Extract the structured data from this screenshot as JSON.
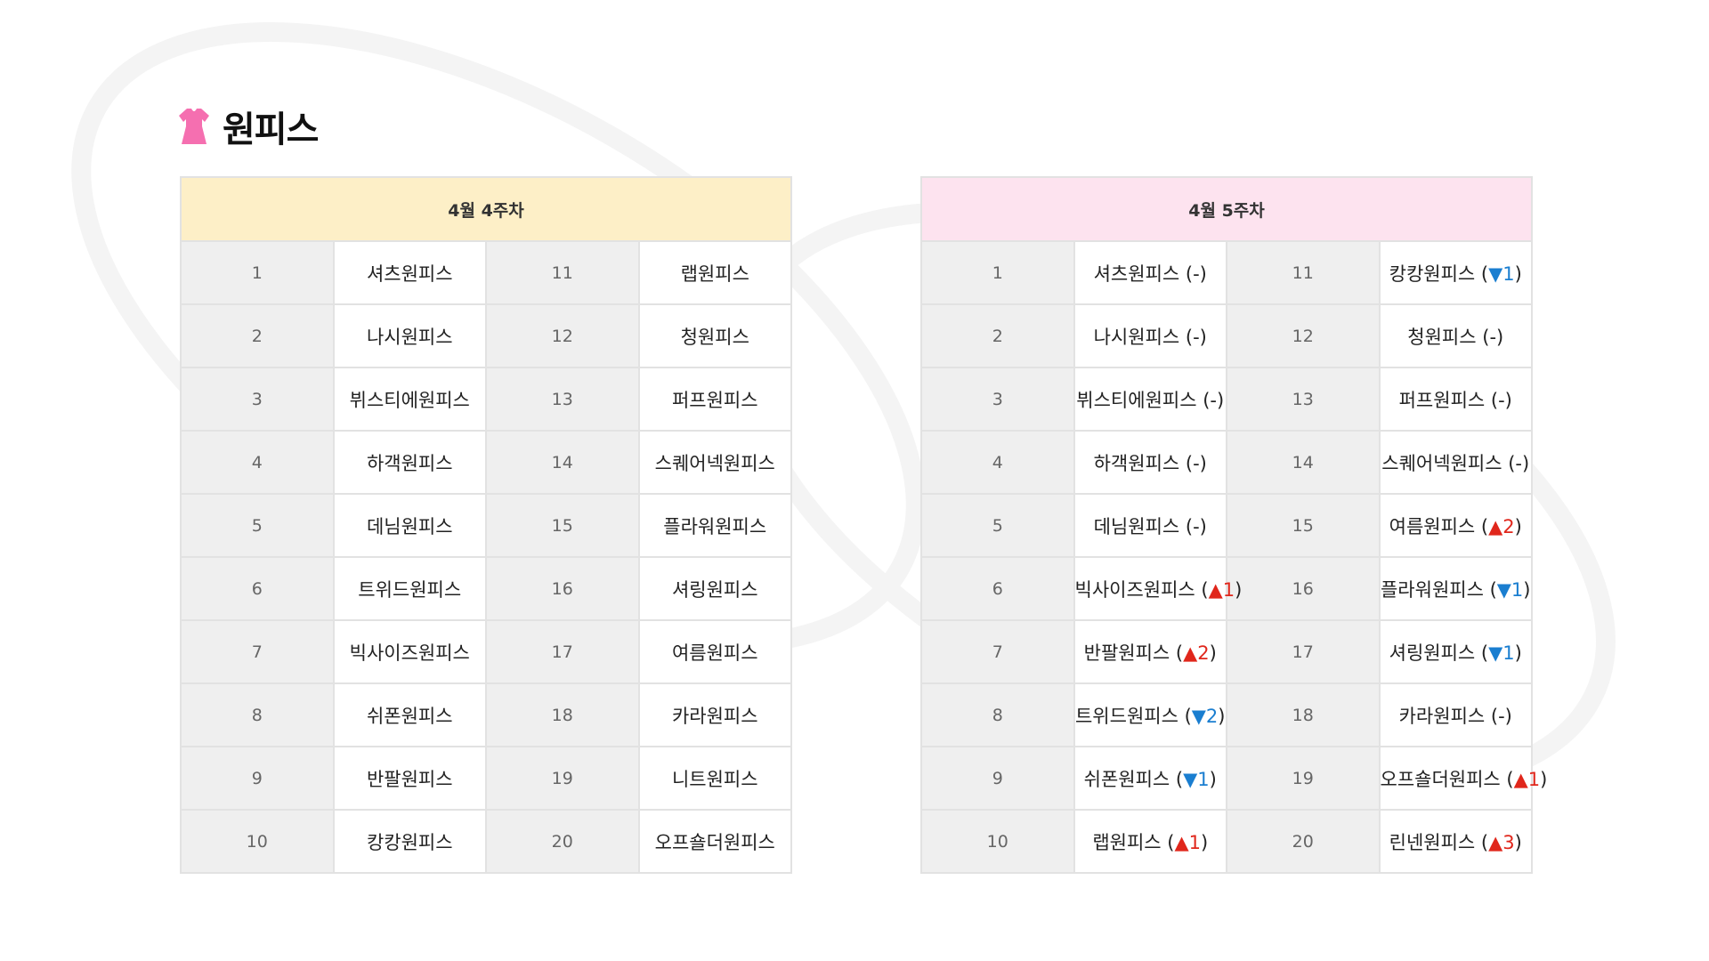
{
  "section": {
    "title": "원피스",
    "icon": "dress-icon",
    "icon_color": "#f56fb0"
  },
  "colors": {
    "left_header_bg": "#fdefc7",
    "right_header_bg": "#fde3ef",
    "up": "#e0261b",
    "down": "#1a7ed0"
  },
  "tables": [
    {
      "title": "4월 4주차",
      "rows": [
        {
          "ranks": [
            "1",
            "11"
          ],
          "cells": [
            {
              "name": "셔츠원피스"
            },
            {
              "name": "랩원피스"
            }
          ]
        },
        {
          "ranks": [
            "2",
            "12"
          ],
          "cells": [
            {
              "name": "나시원피스"
            },
            {
              "name": "청원피스"
            }
          ]
        },
        {
          "ranks": [
            "3",
            "13"
          ],
          "cells": [
            {
              "name": "뷔스티에원피스"
            },
            {
              "name": "퍼프원피스"
            }
          ]
        },
        {
          "ranks": [
            "4",
            "14"
          ],
          "cells": [
            {
              "name": "하객원피스"
            },
            {
              "name": "스퀘어넥원피스"
            }
          ]
        },
        {
          "ranks": [
            "5",
            "15"
          ],
          "cells": [
            {
              "name": "데님원피스"
            },
            {
              "name": "플라워원피스"
            }
          ]
        },
        {
          "ranks": [
            "6",
            "16"
          ],
          "cells": [
            {
              "name": "트위드원피스"
            },
            {
              "name": "셔링원피스"
            }
          ]
        },
        {
          "ranks": [
            "7",
            "17"
          ],
          "cells": [
            {
              "name": "빅사이즈원피스"
            },
            {
              "name": "여름원피스"
            }
          ]
        },
        {
          "ranks": [
            "8",
            "18"
          ],
          "cells": [
            {
              "name": "쉬폰원피스"
            },
            {
              "name": "카라원피스"
            }
          ]
        },
        {
          "ranks": [
            "9",
            "19"
          ],
          "cells": [
            {
              "name": "반팔원피스"
            },
            {
              "name": "니트원피스"
            }
          ]
        },
        {
          "ranks": [
            "10",
            "20"
          ],
          "cells": [
            {
              "name": "캉캉원피스"
            },
            {
              "name": "오프숄더원피스"
            }
          ]
        }
      ]
    },
    {
      "title": "4월 5주차",
      "rows": [
        {
          "ranks": [
            "1",
            "11"
          ],
          "cells": [
            {
              "name": "셔츠원피스",
              "change": {
                "text": "-",
                "dir": "same"
              }
            },
            {
              "name": "캉캉원피스",
              "change": {
                "text": "▼1",
                "dir": "down"
              }
            }
          ]
        },
        {
          "ranks": [
            "2",
            "12"
          ],
          "cells": [
            {
              "name": "나시원피스",
              "change": {
                "text": "-",
                "dir": "same"
              }
            },
            {
              "name": "청원피스",
              "change": {
                "text": "-",
                "dir": "same"
              }
            }
          ]
        },
        {
          "ranks": [
            "3",
            "13"
          ],
          "cells": [
            {
              "name": "뷔스티에원피스",
              "change": {
                "text": "-",
                "dir": "same"
              }
            },
            {
              "name": "퍼프원피스",
              "change": {
                "text": "-",
                "dir": "same"
              }
            }
          ]
        },
        {
          "ranks": [
            "4",
            "14"
          ],
          "cells": [
            {
              "name": "하객원피스",
              "change": {
                "text": "-",
                "dir": "same"
              }
            },
            {
              "name": "스퀘어넥원피스",
              "change": {
                "text": "-",
                "dir": "same"
              }
            }
          ]
        },
        {
          "ranks": [
            "5",
            "15"
          ],
          "cells": [
            {
              "name": "데님원피스",
              "change": {
                "text": "-",
                "dir": "same"
              }
            },
            {
              "name": "여름원피스",
              "change": {
                "text": "▲2",
                "dir": "up"
              }
            }
          ]
        },
        {
          "ranks": [
            "6",
            "16"
          ],
          "cells": [
            {
              "name": "빅사이즈원피스",
              "change": {
                "text": "▲1",
                "dir": "up"
              }
            },
            {
              "name": "플라워원피스",
              "change": {
                "text": "▼1",
                "dir": "down"
              }
            }
          ]
        },
        {
          "ranks": [
            "7",
            "17"
          ],
          "cells": [
            {
              "name": "반팔원피스",
              "change": {
                "text": "▲2",
                "dir": "up"
              }
            },
            {
              "name": "셔링원피스",
              "change": {
                "text": "▼1",
                "dir": "down"
              }
            }
          ]
        },
        {
          "ranks": [
            "8",
            "18"
          ],
          "cells": [
            {
              "name": "트위드원피스",
              "change": {
                "text": "▼2",
                "dir": "down"
              }
            },
            {
              "name": "카라원피스",
              "change": {
                "text": "-",
                "dir": "same"
              }
            }
          ]
        },
        {
          "ranks": [
            "9",
            "19"
          ],
          "cells": [
            {
              "name": "쉬폰원피스",
              "change": {
                "text": "▼1",
                "dir": "down"
              }
            },
            {
              "name": "오프숄더원피스",
              "change": {
                "text": "▲1",
                "dir": "up"
              }
            }
          ]
        },
        {
          "ranks": [
            "10",
            "20"
          ],
          "cells": [
            {
              "name": "랩원피스",
              "change": {
                "text": "▲1",
                "dir": "up"
              }
            },
            {
              "name": "린넨원피스",
              "change": {
                "text": "▲3",
                "dir": "up"
              }
            }
          ]
        }
      ]
    }
  ]
}
